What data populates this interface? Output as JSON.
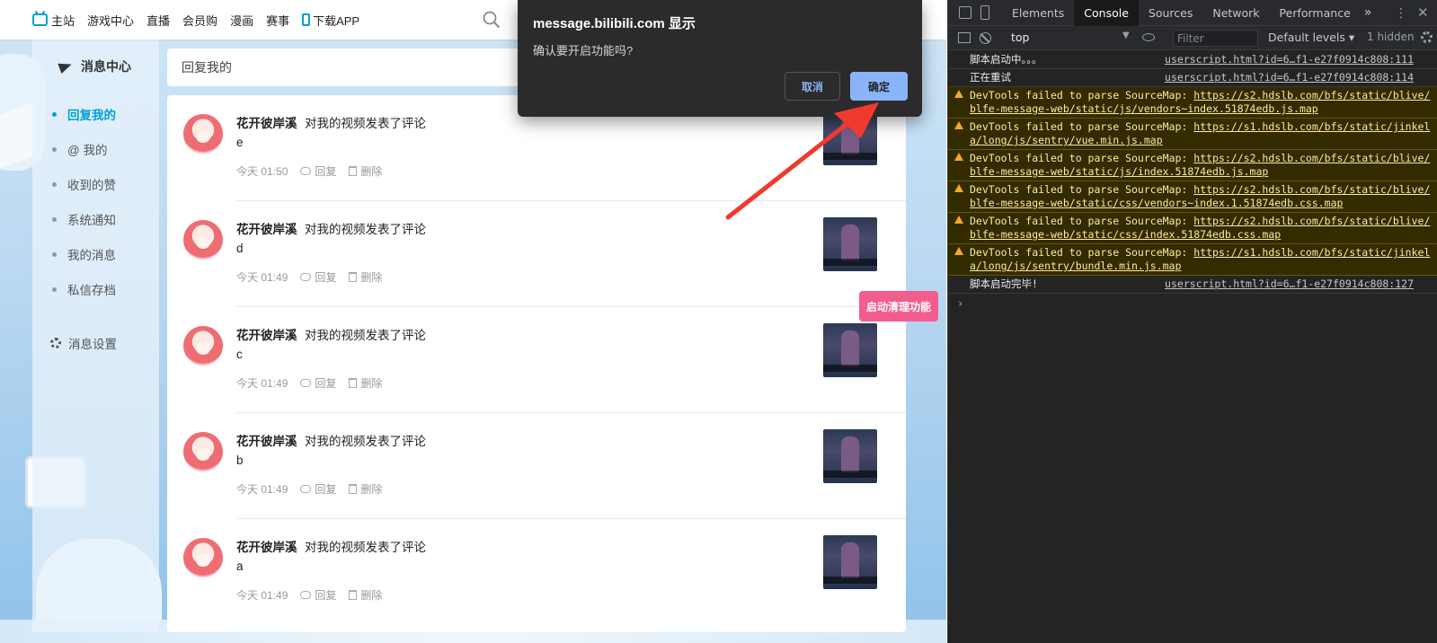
{
  "browser": {
    "topnav": [
      {
        "label": "主站",
        "icon": "tv-icon"
      },
      {
        "label": "游戏中心"
      },
      {
        "label": "直播"
      },
      {
        "label": "会员购"
      },
      {
        "label": "漫画"
      },
      {
        "label": "赛事"
      },
      {
        "label": "下载APP",
        "icon": "phone-icon"
      }
    ],
    "sidebar": {
      "title": "消息中心",
      "items": [
        {
          "label": "回复我的",
          "active": true
        },
        {
          "label": "@ 我的"
        },
        {
          "label": "收到的赞"
        },
        {
          "label": "系统通知"
        },
        {
          "label": "我的消息"
        },
        {
          "label": "私信存档"
        }
      ],
      "settings": "消息设置"
    },
    "header": "回复我的",
    "replies": [
      {
        "user": "花开彼岸溪",
        "action": "对我的视频发表了评论",
        "content": "e",
        "time": "今天 01:50"
      },
      {
        "user": "花开彼岸溪",
        "action": "对我的视频发表了评论",
        "content": "d",
        "time": "今天 01:49"
      },
      {
        "user": "花开彼岸溪",
        "action": "对我的视频发表了评论",
        "content": "c",
        "time": "今天 01:49"
      },
      {
        "user": "花开彼岸溪",
        "action": "对我的视频发表了评论",
        "content": "b",
        "time": "今天 01:49"
      },
      {
        "user": "花开彼岸溪",
        "action": "对我的视频发表了评论",
        "content": "a",
        "time": "今天 01:49"
      }
    ],
    "reply_label": "回复",
    "delete_label": "删除",
    "clean_button": "启动清理功能",
    "dialog": {
      "title": "message.bilibili.com 显示",
      "message": "确认要开启功能吗?",
      "cancel": "取消",
      "ok": "确定"
    }
  },
  "devtools": {
    "tabs": [
      "Elements",
      "Console",
      "Sources",
      "Network",
      "Performance"
    ],
    "active_tab": "Console",
    "more": "»",
    "context": "top",
    "filter_placeholder": "Filter",
    "levels": "Default levels ▾",
    "hidden_count": "1 hidden",
    "logs": [
      {
        "type": "log",
        "message": "脚本启动中。。。",
        "source": "userscript.html?id=6…f1-e27f0914c808:111"
      },
      {
        "type": "log",
        "message": "正在重试",
        "source": "userscript.html?id=6…f1-e27f0914c808:114"
      },
      {
        "type": "warn",
        "message": "DevTools failed to parse SourceMap:",
        "link": "https://s2.hdslb.com/bfs/static/blive/blfe-message-web/static/js/vendors~index.51874edb.js.map"
      },
      {
        "type": "warn",
        "message": "DevTools failed to parse SourceMap:",
        "link": "https://s1.hdslb.com/bfs/static/jinkela/long/js/sentry/vue.min.js.map"
      },
      {
        "type": "warn",
        "message": "DevTools failed to parse SourceMap:",
        "link": "https://s2.hdslb.com/bfs/static/blive/blfe-message-web/static/js/index.51874edb.js.map"
      },
      {
        "type": "warn",
        "message": "DevTools failed to parse SourceMap:",
        "link": "https://s2.hdslb.com/bfs/static/blive/blfe-message-web/static/css/vendors~index.1.51874edb.css.map"
      },
      {
        "type": "warn",
        "message": "DevTools failed to parse SourceMap:",
        "link": "https://s2.hdslb.com/bfs/static/blive/blfe-message-web/static/css/index.51874edb.css.map"
      },
      {
        "type": "warn",
        "message": "DevTools failed to parse SourceMap:",
        "link": "https://s1.hdslb.com/bfs/static/jinkela/long/js/sentry/bundle.min.js.map"
      },
      {
        "type": "log",
        "message": "脚本启动完毕!",
        "source": "userscript.html?id=6…f1-e27f0914c808:127"
      }
    ],
    "prompt": "›"
  },
  "colors": {
    "accent": "#00a1d6",
    "pink": "#f25d8e",
    "dialog_ok": "#8ab4f8",
    "warning_bg": "#332b00"
  }
}
